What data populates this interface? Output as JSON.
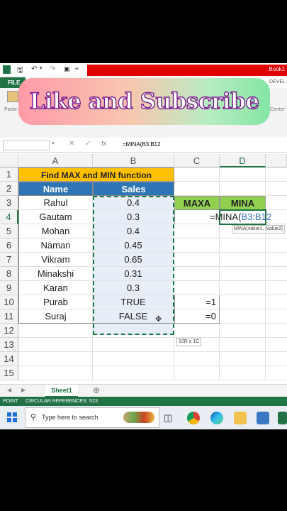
{
  "window": {
    "doc_title": "Book1"
  },
  "ribbon": {
    "file_tab": "FILE",
    "devel_tab": "DEVEL",
    "paste_label": "Paste",
    "center_label": "Center"
  },
  "overlay": {
    "text": "Like and Subscribe"
  },
  "formula_bar": {
    "formula": "=MINA(B3:B12"
  },
  "columns": [
    "A",
    "B",
    "C",
    "D"
  ],
  "rows": [
    "1",
    "2",
    "3",
    "4",
    "5",
    "6",
    "7",
    "8",
    "9",
    "10",
    "11",
    "12",
    "13",
    "14",
    "15"
  ],
  "sheet": {
    "title": "Find MAX and MIN function",
    "header_name": "Name",
    "header_sales": "Sales",
    "data": [
      {
        "name": "Rahul",
        "sales": "0.4"
      },
      {
        "name": "Gautam",
        "sales": "0.3"
      },
      {
        "name": "Mohan",
        "sales": "0.4"
      },
      {
        "name": "Naman",
        "sales": "0.45"
      },
      {
        "name": "Vikram",
        "sales": "0.65"
      },
      {
        "name": "Minakshi",
        "sales": "0.31"
      },
      {
        "name": "Karan",
        "sales": "0.3"
      },
      {
        "name": "Purab",
        "sales": "TRUE"
      },
      {
        "name": "Suraj",
        "sales": "FALSE"
      }
    ],
    "maxa_label": "MAXA",
    "mina_label": "MINA",
    "edit_prefix": "=MINA(",
    "edit_range": "B3:B12",
    "c10": "=1",
    "c11": "=0",
    "func_tooltip": "MINA(value1, [value2]",
    "size_tooltip": "10R x 1C"
  },
  "sheet_tabs": {
    "active": "Sheet1"
  },
  "status": {
    "mode": "POINT",
    "circular": "CIRCULAR REFERENCES: S23"
  },
  "taskbar": {
    "search_placeholder": "Type here to search"
  },
  "colors": {
    "excel_green": "#217346",
    "title_fill": "#ffc000",
    "header_fill": "#2e75b6",
    "label_fill": "#92d050"
  }
}
